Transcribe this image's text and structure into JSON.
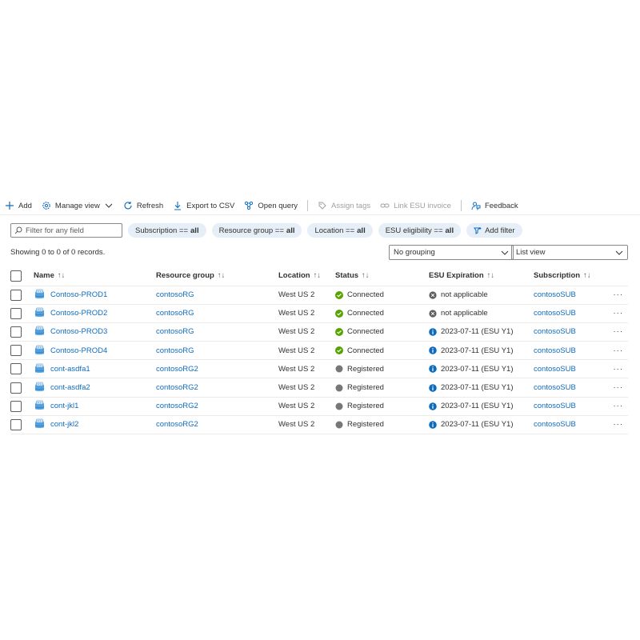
{
  "toolbar": {
    "add": "Add",
    "manage_view": "Manage view",
    "refresh": "Refresh",
    "export_csv": "Export to CSV",
    "open_query": "Open query",
    "assign_tags": "Assign tags",
    "link_esu_invoice": "Link ESU invoice",
    "feedback": "Feedback"
  },
  "filters": {
    "search_placeholder": "Filter for any field",
    "pills": [
      {
        "label": "Subscription ==",
        "value": "all"
      },
      {
        "label": "Resource group ==",
        "value": "all"
      },
      {
        "label": "Location ==",
        "value": "all"
      },
      {
        "label": "ESU eligibility ==",
        "value": "all"
      }
    ],
    "add_filter": "Add filter"
  },
  "records_text": "Showing 0 to 0 of 0 records.",
  "grouping": "No grouping",
  "view": "List view",
  "colors": {
    "accent": "#0f6cbd",
    "connected": "#57a300",
    "registered": "#797775",
    "info": "#0f6cbd",
    "na": "#605e5c"
  },
  "columns": [
    "Name",
    "Resource group",
    "Location",
    "Status",
    "ESU Expiration",
    "Subscription"
  ],
  "rows": [
    {
      "name": "Contoso-PROD1",
      "rg": "contosoRG",
      "location": "West US 2",
      "status": "Connected",
      "esu": "not applicable",
      "esu_icon": "na",
      "sub": "contosoSUB"
    },
    {
      "name": "Contoso-PROD2",
      "rg": "contosoRG",
      "location": "West US 2",
      "status": "Connected",
      "esu": "not applicable",
      "esu_icon": "na",
      "sub": "contosoSUB"
    },
    {
      "name": "Contoso-PROD3",
      "rg": "contosoRG",
      "location": "West US 2",
      "status": "Connected",
      "esu": "2023-07-11 (ESU Y1)",
      "esu_icon": "info",
      "sub": "contosoSUB"
    },
    {
      "name": "Contoso-PROD4",
      "rg": "contosoRG",
      "location": "West US 2",
      "status": "Connected",
      "esu": "2023-07-11 (ESU Y1)",
      "esu_icon": "info",
      "sub": "contosoSUB"
    },
    {
      "name": "cont-asdfa1",
      "rg": "contosoRG2",
      "location": "West US 2",
      "status": "Registered",
      "esu": "2023-07-11 (ESU Y1)",
      "esu_icon": "info",
      "sub": "contosoSUB"
    },
    {
      "name": "cont-asdfa2",
      "rg": "contosoRG2",
      "location": "West US 2",
      "status": "Registered",
      "esu": "2023-07-11 (ESU Y1)",
      "esu_icon": "info",
      "sub": "contosoSUB"
    },
    {
      "name": "cont-jkl1",
      "rg": "contosoRG2",
      "location": "West US 2",
      "status": "Registered",
      "esu": "2023-07-11 (ESU Y1)",
      "esu_icon": "info",
      "sub": "contosoSUB"
    },
    {
      "name": "cont-jkl2",
      "rg": "contosoRG2",
      "location": "West US 2",
      "status": "Registered",
      "esu": "2023-07-11 (ESU Y1)",
      "esu_icon": "info",
      "sub": "contosoSUB"
    }
  ]
}
